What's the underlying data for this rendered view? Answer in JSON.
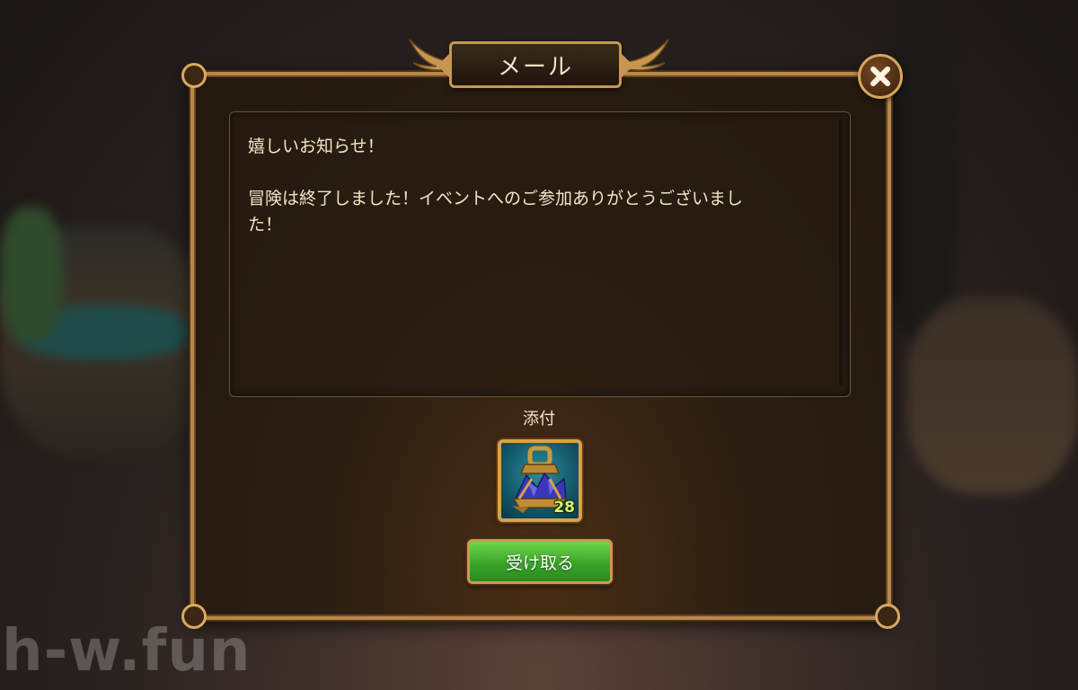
{
  "dialog": {
    "title": "メール",
    "close_icon": "close-x-icon"
  },
  "message": {
    "greeting": "嬉しいお知らせ！",
    "body_line1": "冒険は終了しました！イベントへのご参加ありがとうございまし",
    "body_line2": "た！"
  },
  "attachment": {
    "label": "添付",
    "items": [
      {
        "icon": "event-lantern-item-icon",
        "count": "28"
      }
    ]
  },
  "actions": {
    "claim_label": "受け取る"
  },
  "watermark": "h-w.fun",
  "colors": {
    "frame_gold": "#b8874a",
    "panel_brown": "#2b1e12",
    "text_cream": "#f4e5c8",
    "claim_green": "#3aa52a",
    "count_yellow": "#d8f56a"
  }
}
